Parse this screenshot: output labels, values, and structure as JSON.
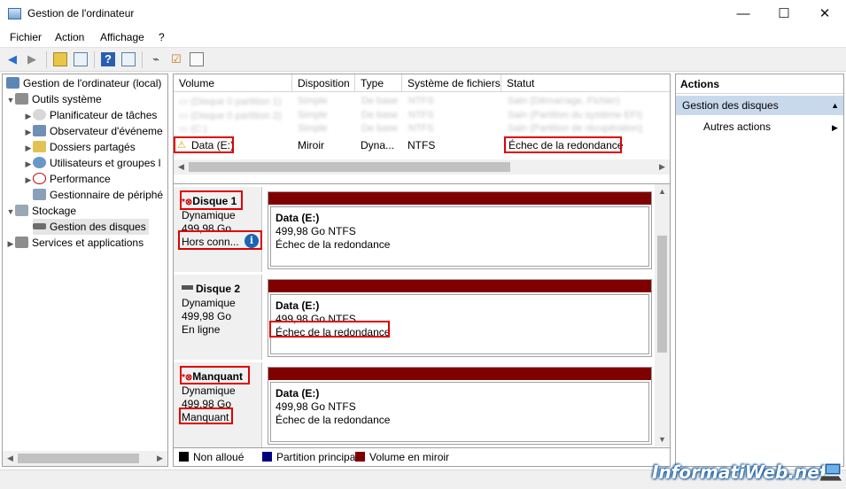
{
  "window": {
    "title": "Gestion de l'ordinateur",
    "min_glyph": "—",
    "max_glyph": "☐",
    "close_glyph": "✕"
  },
  "menu": [
    "Fichier",
    "Action",
    "Affichage",
    "?"
  ],
  "tree": {
    "root": "Gestion de l'ordinateur (local)",
    "items": [
      "Outils système",
      "Planificateur de tâches",
      "Observateur d'événeme",
      "Dossiers partagés",
      "Utilisateurs et groupes l",
      "Performance",
      "Gestionnaire de périphé",
      "Stockage",
      "Gestion des disques",
      "Services et applications"
    ]
  },
  "volumes": {
    "columns": [
      "Volume",
      "Disposition",
      "Type",
      "Système de fichiers",
      "Statut"
    ],
    "data_row": {
      "volume": "Data (E:)",
      "disposition": "Miroir",
      "type": "Dyna...",
      "fs": "NTFS",
      "status": "Échec de la redondance"
    }
  },
  "disks": [
    {
      "name": "Disque 1",
      "kind": "Dynamique",
      "size": "499,98 Go",
      "state": "Hors conn...",
      "volume": "Data  (E:)",
      "detail": "499,98 Go NTFS",
      "status": "Échec de la redondance"
    },
    {
      "name": "Disque 2",
      "kind": "Dynamique",
      "size": "499,98 Go",
      "state": "En ligne",
      "volume": "Data  (E:)",
      "detail": "499,98 Go NTFS",
      "status": "Échec de la redondance"
    },
    {
      "name": "Manquant",
      "kind": "Dynamique",
      "size": "499,98 Go",
      "state": "Manquant",
      "volume": "Data  (E:)",
      "detail": "499,98 Go NTFS",
      "status": "Échec de la redondance"
    }
  ],
  "legend": [
    {
      "label": "Non alloué",
      "color": "#000000"
    },
    {
      "label": "Partition principale",
      "color": "#000080"
    },
    {
      "label": "Volume en miroir",
      "color": "#800000"
    }
  ],
  "actions": {
    "title": "Actions",
    "section": "Gestion des disques",
    "other": "Autres actions"
  },
  "watermark": "InformatiWeb.net",
  "colors": {
    "mirror": "#800000",
    "highlight": "#e00000",
    "selection": "#c9d9ec"
  }
}
